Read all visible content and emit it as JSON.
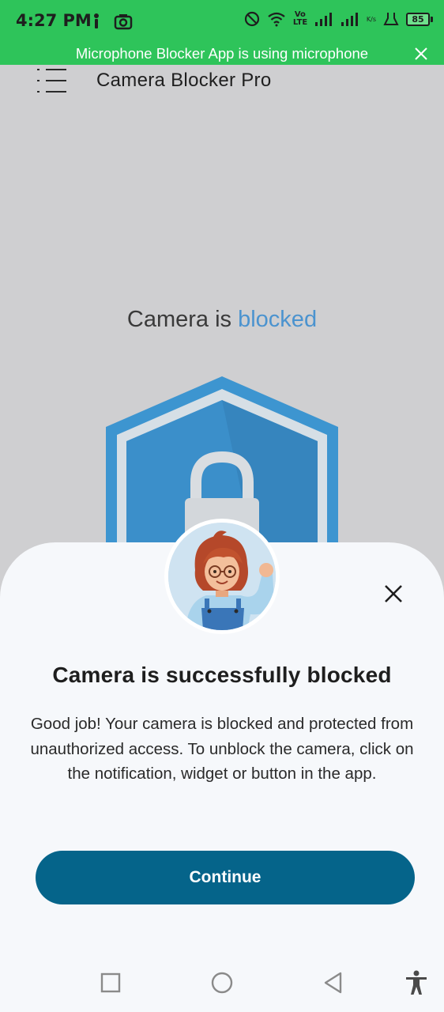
{
  "status_bar": {
    "time": "4:27 PM",
    "battery_level": "85",
    "network_label": "Vo LTE",
    "speed_label": "K/s"
  },
  "notification": {
    "text": "Microphone Blocker App is using microphone"
  },
  "app_bar": {
    "title": "Camera Blocker Pro"
  },
  "main": {
    "status_prefix": "Camera is ",
    "status_value": "blocked"
  },
  "dialog": {
    "title": "Camera is successfully blocked",
    "body": "Good job! Your camera is blocked and protected from unauthorized access. To unblock the camera, click on the notification, widget or button in the app.",
    "continue_label": "Continue"
  },
  "colors": {
    "status_bar": "#2ec45a",
    "accent": "#4b93cf",
    "button": "#05648a",
    "background": "#cfcfd1",
    "sheet": "#f6f8fb"
  },
  "icons": {
    "status_left": [
      "info-icon",
      "camera-icon"
    ],
    "status_right": [
      "do-not-disturb-icon",
      "wifi-icon",
      "signal-icon",
      "signal-icon",
      "battery-icon"
    ],
    "nav": [
      "recents-icon",
      "home-icon",
      "back-icon",
      "accessibility-icon"
    ]
  }
}
